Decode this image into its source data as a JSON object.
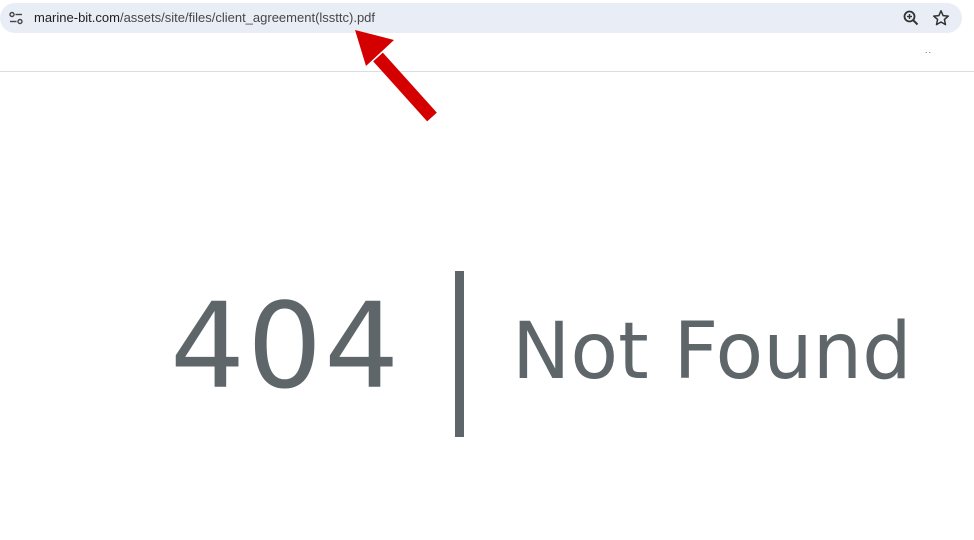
{
  "browser": {
    "url_host": "marine-bit.com",
    "url_path": "/assets/site/files/client_agreement(lssttc).pdf",
    "site_info_icon": "tune-icon",
    "zoom_icon": "zoom-in-icon",
    "bookmark_icon": "star-icon",
    "overflow_text": "..",
    "annotation_arrow_color": "#d40000"
  },
  "content": {
    "code": "404",
    "message": "Not Found",
    "text_color": "#5e666a"
  }
}
